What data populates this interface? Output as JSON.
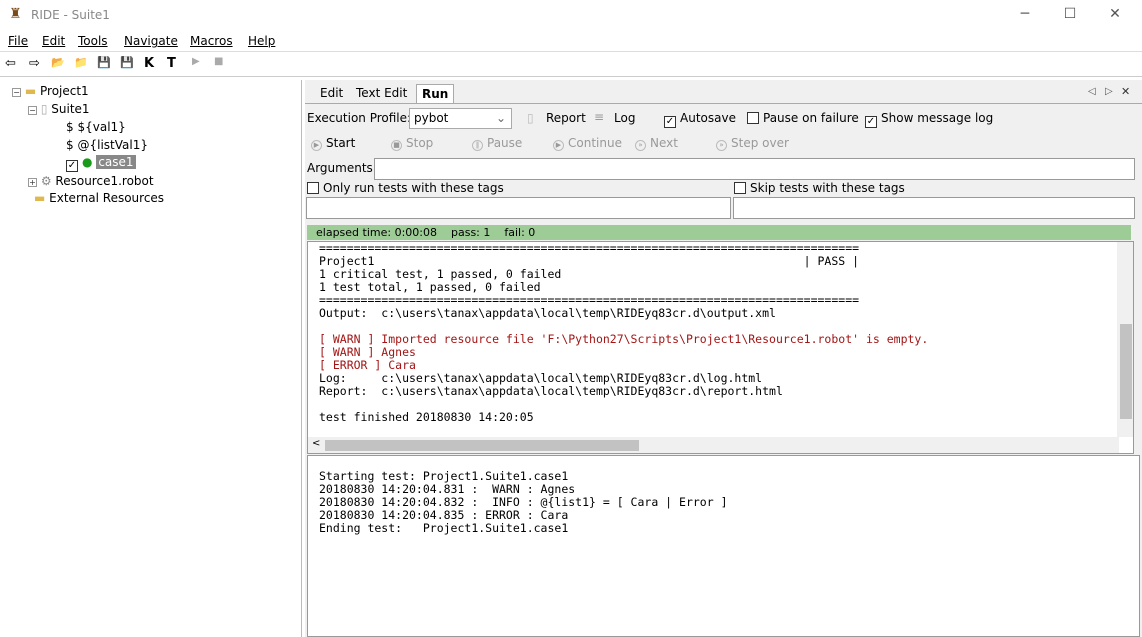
{
  "window": {
    "title": "RIDE - Suite1",
    "minimize": "─",
    "maximize": "☐",
    "close": "✕"
  },
  "menu": [
    "File",
    "Edit",
    "Tools",
    "Navigate",
    "Macros",
    "Help"
  ],
  "toolbar": [
    "⇦",
    "⇨",
    "📂",
    "📁",
    "💾",
    "💾",
    "K",
    "T",
    "▶",
    "■"
  ],
  "tree": {
    "project": "Project1",
    "suite": "Suite1",
    "var1": "${val1}",
    "var2": "@{listVal1}",
    "testcase": "case1",
    "resource": "Resource1.robot",
    "external": "External Resources"
  },
  "tabs": [
    "Edit",
    "Text Edit",
    "Run"
  ],
  "active_tab": "Run",
  "tab_controls": {
    "prev": "◁",
    "next": "▷",
    "close": "✕"
  },
  "run": {
    "profile_label": "Execution Profile:",
    "profile_value": "pybot",
    "report": "Report",
    "log": "Log",
    "autosave": {
      "label": "Autosave",
      "checked": true
    },
    "pause_on_failure": {
      "label": "Pause on failure",
      "checked": false
    },
    "show_message_log": {
      "label": "Show message log",
      "checked": true
    },
    "buttons": [
      "Start",
      "Stop",
      "Pause",
      "Continue",
      "Next",
      "Step over"
    ],
    "arguments_label": "Arguments:",
    "arguments_value": "",
    "only_tags": {
      "label": "Only run tests with these tags",
      "checked": false
    },
    "skip_tags": {
      "label": "Skip tests with these tags",
      "checked": false
    },
    "status": {
      "elapsed": "elapsed time: 0:00:08",
      "pass": "pass: 1",
      "fail": "fail: 0"
    }
  },
  "output_lines": [
    {
      "text": "==============================================================================",
      "type": "normal"
    },
    {
      "text": "Project1                                                              | PASS |",
      "type": "normal"
    },
    {
      "text": "1 critical test, 1 passed, 0 failed",
      "type": "normal"
    },
    {
      "text": "1 test total, 1 passed, 0 failed",
      "type": "normal"
    },
    {
      "text": "==============================================================================",
      "type": "normal"
    },
    {
      "text": "Output:  c:\\users\\tanax\\appdata\\local\\temp\\RIDEyq83cr.d\\output.xml",
      "type": "normal"
    },
    {
      "text": "",
      "type": "normal"
    },
    {
      "text": "[ WARN ] Imported resource file 'F:\\Python27\\Scripts\\Project1\\Resource1.robot' is empty.",
      "type": "warn"
    },
    {
      "text": "[ WARN ] Agnes",
      "type": "warn"
    },
    {
      "text": "[ ERROR ] Cara",
      "type": "warn"
    },
    {
      "text": "Log:     c:\\users\\tanax\\appdata\\local\\temp\\RIDEyq83cr.d\\log.html",
      "type": "normal"
    },
    {
      "text": "Report:  c:\\users\\tanax\\appdata\\local\\temp\\RIDEyq83cr.d\\report.html",
      "type": "normal"
    },
    {
      "text": "",
      "type": "normal"
    },
    {
      "text": "test finished 20180830 14:20:05",
      "type": "normal"
    }
  ],
  "message_log": [
    "Starting test: Project1.Suite1.case1",
    "20180830 14:20:04.831 :  WARN : Agnes",
    "20180830 14:20:04.832 :  INFO : @{list1} = [ Cara | Error ]",
    "20180830 14:20:04.835 : ERROR : Cara",
    "Ending test:   Project1.Suite1.case1"
  ],
  "colors": {
    "status_pass": "#9ecc96",
    "warn_text": "#a31515",
    "selection": "#888888"
  }
}
